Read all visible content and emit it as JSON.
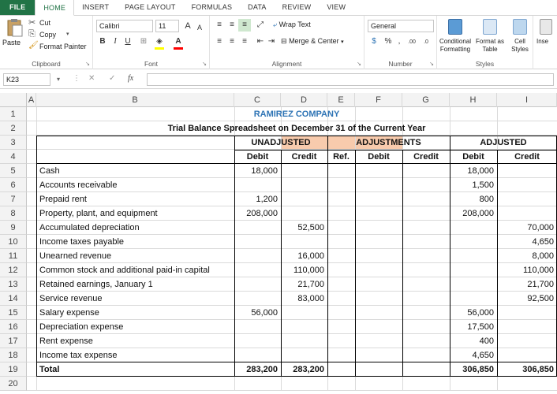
{
  "ribbon_tabs": [
    "FILE",
    "HOME",
    "INSERT",
    "PAGE LAYOUT",
    "FORMULAS",
    "DATA",
    "REVIEW",
    "VIEW"
  ],
  "clipboard": {
    "paste": "Paste",
    "cut": "Cut",
    "copy": "Copy",
    "format_painter": "Format Painter",
    "label": "Clipboard"
  },
  "font": {
    "name": "Calibri",
    "size": "11",
    "bold": "B",
    "italic": "I",
    "underline": "U",
    "grow": "A",
    "shrink": "A",
    "fill_color": "#ffff00",
    "font_color": "#ff0000",
    "label": "Font"
  },
  "alignment": {
    "wrap_text": "Wrap Text",
    "merge_center": "Merge & Center",
    "label": "Alignment"
  },
  "number": {
    "format": "General",
    "currency": "$",
    "percent": "%",
    "comma": ",",
    "inc_decimal": ".00",
    "dec_decimal": ".0",
    "label": "Number"
  },
  "styles": {
    "conditional": "Conditional",
    "conditional2": "Formatting",
    "format_as": "Format as",
    "format_as2": "Table",
    "cell": "Cell",
    "cell2": "Styles",
    "label": "Styles"
  },
  "cells_group": {
    "insert": "Inse"
  },
  "formula_bar": {
    "name_box": "K23",
    "fx": "fx",
    "formula": ""
  },
  "columns": [
    "A",
    "B",
    "C",
    "D",
    "E",
    "F",
    "G",
    "H",
    "I"
  ],
  "rows": [
    "1",
    "2",
    "3",
    "4",
    "5",
    "6",
    "7",
    "8",
    "9",
    "10",
    "11",
    "12",
    "13",
    "14",
    "15",
    "16",
    "17",
    "18",
    "19",
    "20"
  ],
  "sheet": {
    "company": "RAMIREZ COMPANY",
    "subtitle": "Trial Balance Spreadsheet on December 31 of the Current Year",
    "unadjusted": "UNADJUSTED",
    "adjustments": "ADJUSTMENTS",
    "adjusted": "ADJUSTED",
    "adj_color": "#f8cbad",
    "heads": {
      "debit": "Debit",
      "credit": "Credit",
      "ref": "Ref."
    },
    "accounts": [
      {
        "name": "Cash",
        "u_debit": "18,000",
        "u_credit": "",
        "a_debit": "18,000",
        "a_credit": ""
      },
      {
        "name": "Accounts receivable",
        "u_debit": "",
        "u_credit": "",
        "a_debit": "1,500",
        "a_credit": ""
      },
      {
        "name": "Prepaid rent",
        "u_debit": "1,200",
        "u_credit": "",
        "a_debit": "800",
        "a_credit": ""
      },
      {
        "name": "Property, plant, and equipment",
        "u_debit": "208,000",
        "u_credit": "",
        "a_debit": "208,000",
        "a_credit": ""
      },
      {
        "name": "Accumulated depreciation",
        "u_debit": "",
        "u_credit": "52,500",
        "a_debit": "",
        "a_credit": "70,000"
      },
      {
        "name": "Income taxes payable",
        "u_debit": "",
        "u_credit": "",
        "a_debit": "",
        "a_credit": "4,650"
      },
      {
        "name": "Unearned revenue",
        "u_debit": "",
        "u_credit": "16,000",
        "a_debit": "",
        "a_credit": "8,000"
      },
      {
        "name": "Common stock and additional paid-in capital",
        "u_debit": "",
        "u_credit": "110,000",
        "a_debit": "",
        "a_credit": "110,000"
      },
      {
        "name": "Retained earnings, January 1",
        "u_debit": "",
        "u_credit": "21,700",
        "a_debit": "",
        "a_credit": "21,700"
      },
      {
        "name": "Service revenue",
        "u_debit": "",
        "u_credit": "83,000",
        "a_debit": "",
        "a_credit": "92,500"
      },
      {
        "name": "Salary expense",
        "u_debit": "56,000",
        "u_credit": "",
        "a_debit": "56,000",
        "a_credit": ""
      },
      {
        "name": "Depreciation expense",
        "u_debit": "",
        "u_credit": "",
        "a_debit": "17,500",
        "a_credit": ""
      },
      {
        "name": "Rent expense",
        "u_debit": "",
        "u_credit": "",
        "a_debit": "400",
        "a_credit": ""
      },
      {
        "name": "Income tax expense",
        "u_debit": "",
        "u_credit": "",
        "a_debit": "4,650",
        "a_credit": ""
      }
    ],
    "total": {
      "name": "Total",
      "u_debit": "283,200",
      "u_credit": "283,200",
      "a_debit": "306,850",
      "a_credit": "306,850"
    }
  }
}
